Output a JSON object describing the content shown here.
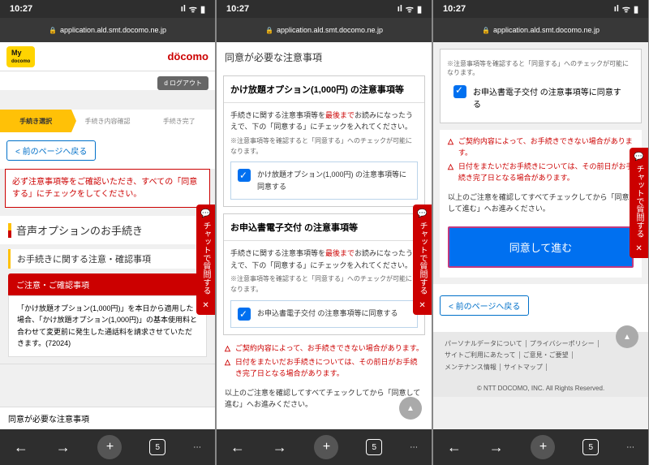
{
  "status": {
    "time": "10:27",
    "signal": "ıl",
    "wifi": "ᯤ",
    "battery": "▮"
  },
  "nav": {
    "url": "application.ald.smt.docomo.ne.jp"
  },
  "screen1": {
    "my_label": "My",
    "my_sub": "docomo",
    "brand": "döcomo",
    "logout": "d ログアウト",
    "steps": [
      "手続き選択",
      "手続き内容確認",
      "手続き完了"
    ],
    "back": "< 前のページへ戻る",
    "alert": "必ず注意事項等をご確認いただき、すべての「同意する」にチェックをしてください。",
    "title": "音声オプションのお手続き",
    "subtitle": "お手続きに関する注意・確認事項",
    "red_label": "ご注意・ご確認事項",
    "note": "「かけ放題オプション(1,000円)」を本日から適用した場合、「かけ放題オプション(1,000円)」の基本使用料と合わせて変更前に発生した通話料を請求させていただきます。(72024)",
    "cutoff": "同意が必要な注意事項"
  },
  "screen2": {
    "partial_title": "同意が必要な注意事項",
    "card1": {
      "title": "かけ放題オプション(1,000円) の注意事項等",
      "body_a": "手続きに関する注意事項等を",
      "body_red": "最後まで",
      "body_b": "お読みになったうえで、下の「同意する」にチェックを入れてください。",
      "note": "※注意事項等を確認すると「同意する」へのチェックが可能になります。",
      "check": "かけ放題オプション(1,000円) の注意事項等に同意する"
    },
    "card2": {
      "title": "お申込書電子交付 の注意事項等",
      "body_a": "手続きに関する注意事項等を",
      "body_red": "最後まで",
      "body_b": "お読みになったうえで、下の「同意する」にチェックを入れてください。",
      "note": "※注意事項等を確認すると「同意する」へのチェックが可能になります。",
      "check": "お申込書電子交付 の注意事項等に同意する"
    },
    "warn1": "ご契約内容によって、お手続きできない場合があります。",
    "warn2": "日付をまたいだお手続きについては、その前日がお手続き完了日となる場合があります。",
    "instruction": "以上のご注意を確認してすべてチェックしてから「同意して進む」へお進みください。"
  },
  "screen3": {
    "note": "※注意事項等を確認すると「同意する」へのチェックが可能になります。",
    "check": "お申込書電子交付 の注意事項等に同意する",
    "warn1": "ご契約内容によって、お手続きできない場合があります。",
    "warn2": "日付をまたいだお手続きについては、その前日がお手続き完了日となる場合があります。",
    "instruction": "以上のご注意を確認してすべてチェックしてから「同意して進む」へお進みください。",
    "primary": "同意して進む",
    "back": "< 前のページへ戻る",
    "footer": [
      "パーソナルデータについて",
      "プライバシーポリシー",
      "サイトご利用にあたって",
      "ご意見・ご要望",
      "メンテナンス情報",
      "サイトマップ"
    ],
    "copyright": "© NTT DOCOMO, INC. All Rights Reserved."
  },
  "chat": {
    "label": "チャットで質問する",
    "close": "✕"
  },
  "bottom": {
    "tabs": "5",
    "plus": "+"
  }
}
